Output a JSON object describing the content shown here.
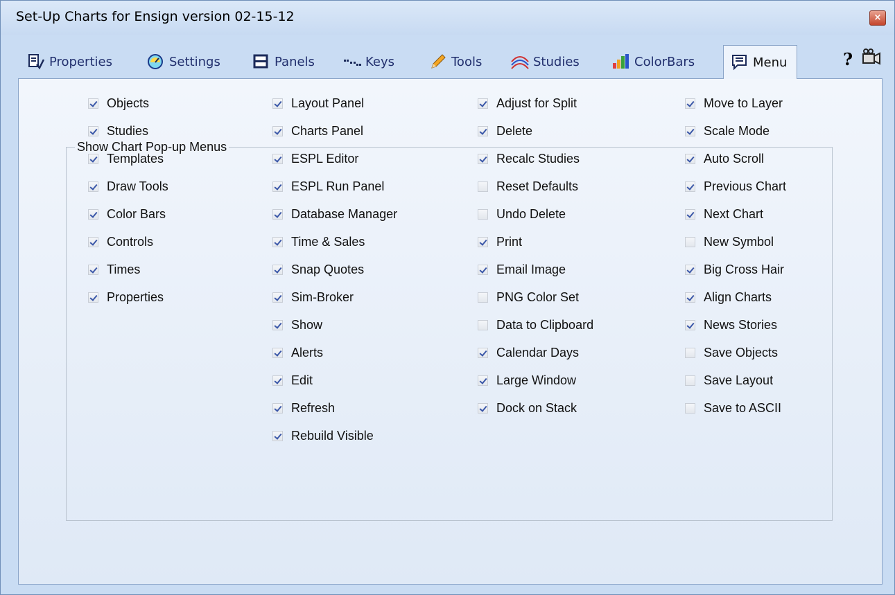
{
  "window": {
    "title": "Set-Up Charts for Ensign version 02-15-12",
    "close_label": "×"
  },
  "tabs": [
    {
      "label": "Properties",
      "icon": "properties-icon"
    },
    {
      "label": "Settings",
      "icon": "gauge-icon"
    },
    {
      "label": "Panels",
      "icon": "panels-icon"
    },
    {
      "label": "Keys",
      "icon": "keys-icon"
    },
    {
      "label": "Tools",
      "icon": "pencil-icon"
    },
    {
      "label": "Studies",
      "icon": "studies-icon"
    },
    {
      "label": "ColorBars",
      "icon": "colorbars-icon"
    },
    {
      "label": "Menu",
      "icon": "menu-icon",
      "active": true
    }
  ],
  "toolbar": {
    "help_label": "?",
    "camera_icon": "camera-icon"
  },
  "group": {
    "legend": "Show Chart Pop-up Menus",
    "columns": [
      [
        {
          "label": "Objects",
          "checked": true
        },
        {
          "label": "Studies",
          "checked": true
        },
        {
          "label": "Templates",
          "checked": true
        },
        {
          "label": "Draw Tools",
          "checked": true
        },
        {
          "label": "Color Bars",
          "checked": true
        },
        {
          "label": "Controls",
          "checked": true
        },
        {
          "label": "Times",
          "checked": true
        },
        {
          "label": "Properties",
          "checked": true
        }
      ],
      [
        {
          "label": "Layout Panel",
          "checked": true
        },
        {
          "label": "Charts Panel",
          "checked": true
        },
        {
          "label": "ESPL Editor",
          "checked": true
        },
        {
          "label": "ESPL Run Panel",
          "checked": true
        },
        {
          "label": "Database Manager",
          "checked": true
        },
        {
          "label": "Time & Sales",
          "checked": true
        },
        {
          "label": "Snap Quotes",
          "checked": true
        },
        {
          "label": "Sim-Broker",
          "checked": true
        },
        {
          "label": "Show",
          "checked": true
        },
        {
          "label": "Alerts",
          "checked": true
        },
        {
          "label": "Edit",
          "checked": true
        },
        {
          "label": "Refresh",
          "checked": true
        },
        {
          "label": "Rebuild Visible",
          "checked": true
        }
      ],
      [
        {
          "label": "Adjust for Split",
          "checked": true
        },
        {
          "label": "Delete",
          "checked": true
        },
        {
          "label": "Recalc Studies",
          "checked": true
        },
        {
          "label": "Reset Defaults",
          "checked": false
        },
        {
          "label": "Undo Delete",
          "checked": false
        },
        {
          "label": "Print",
          "checked": true
        },
        {
          "label": "Email Image",
          "checked": true
        },
        {
          "label": "PNG Color Set",
          "checked": false
        },
        {
          "label": "Data to Clipboard",
          "checked": false
        },
        {
          "label": "Calendar Days",
          "checked": true
        },
        {
          "label": "Large Window",
          "checked": true
        },
        {
          "label": "Dock on Stack",
          "checked": true
        }
      ],
      [
        {
          "label": "Move to Layer",
          "checked": true
        },
        {
          "label": "Scale Mode",
          "checked": true
        },
        {
          "label": "Auto Scroll",
          "checked": true
        },
        {
          "label": "Previous Chart",
          "checked": true
        },
        {
          "label": "Next Chart",
          "checked": true
        },
        {
          "label": "New Symbol",
          "checked": false
        },
        {
          "label": "Big Cross Hair",
          "checked": true
        },
        {
          "label": "Align Charts",
          "checked": true
        },
        {
          "label": "News Stories",
          "checked": true
        },
        {
          "label": "Save Objects",
          "checked": false
        },
        {
          "label": "Save Layout",
          "checked": false
        },
        {
          "label": "Save to ASCII",
          "checked": false
        }
      ]
    ]
  }
}
